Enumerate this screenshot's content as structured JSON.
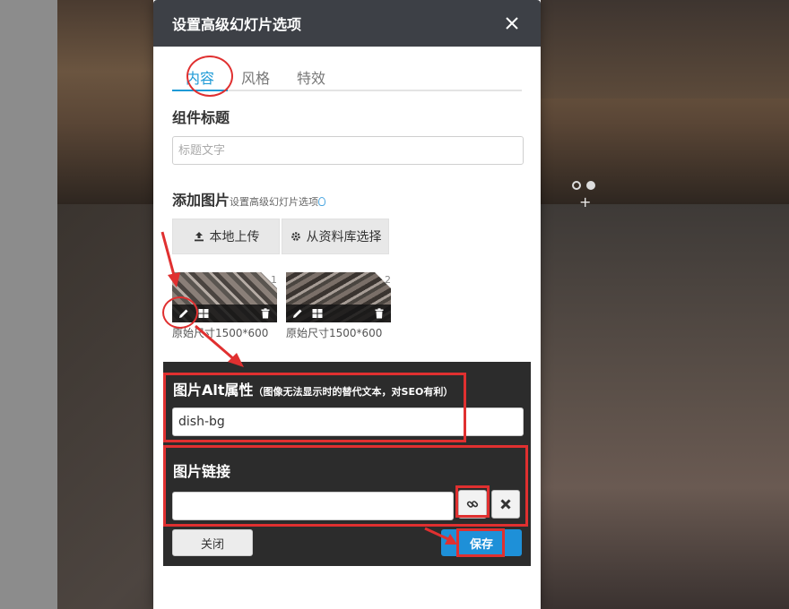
{
  "modal": {
    "title": "设置高级幻灯片选项"
  },
  "tabs": [
    {
      "label": "内容",
      "active": true
    },
    {
      "label": "风格",
      "active": false
    },
    {
      "label": "特效",
      "active": false
    }
  ],
  "component_title": {
    "label": "组件标题",
    "placeholder": "标题文字",
    "value": ""
  },
  "add_images": {
    "label": "添加图片",
    "hint": "设置高级幻灯片选项",
    "upload_local_label": "本地上传",
    "library_label": "从资料库选择"
  },
  "images": [
    {
      "index": "1",
      "size_label": "原始尺寸1500*600"
    },
    {
      "index": "2",
      "size_label": "原始尺寸1500*600"
    }
  ],
  "alt_attr": {
    "label": "图片Alt属性",
    "note": "（图像无法显示时的替代文本，对SEO有利）",
    "value": "dish-bg"
  },
  "image_link": {
    "label": "图片链接",
    "value": ""
  },
  "footer": {
    "close_label": "关闭",
    "save_label": "保存"
  },
  "colors": {
    "accent": "#1e9ad6",
    "header_bg": "#3d4046",
    "annotation_red": "#e03030"
  },
  "icons": [
    "close-icon",
    "upload-icon",
    "gear-icon",
    "pencil-icon",
    "grid-icon",
    "trash-icon",
    "link-icon",
    "remove-icon",
    "lightbulb-icon"
  ]
}
